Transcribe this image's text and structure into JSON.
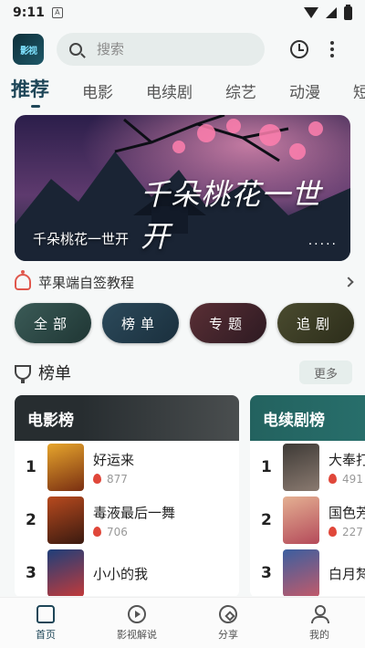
{
  "status_bar": {
    "time": "9:11",
    "notification_letter": "A"
  },
  "app": {
    "logo_text": "影视"
  },
  "search": {
    "placeholder": "搜索"
  },
  "tabs": [
    {
      "label": "推荐"
    },
    {
      "label": "电影"
    },
    {
      "label": "电续剧"
    },
    {
      "label": "综艺"
    },
    {
      "label": "动漫"
    },
    {
      "label": "短"
    }
  ],
  "banner": {
    "caption": "千朵桃花一世开",
    "calligraphy": "千朵桃花一世开",
    "dots": "....."
  },
  "notice": {
    "text": "苹果端自签教程"
  },
  "categories": [
    {
      "label": "全部"
    },
    {
      "label": "榜单"
    },
    {
      "label": "专题"
    },
    {
      "label": "追剧"
    }
  ],
  "ranking": {
    "title": "榜单",
    "more_label": "更多",
    "cards": [
      {
        "title": "电影榜",
        "items": [
          {
            "rank": "1",
            "title": "好运来",
            "heat": "877"
          },
          {
            "rank": "2",
            "title": "毒液最后一舞",
            "heat": "706"
          },
          {
            "rank": "3",
            "title": "小小的我",
            "heat": ""
          }
        ]
      },
      {
        "title": "电续剧榜",
        "items": [
          {
            "rank": "1",
            "title": "大奉打",
            "heat": "491"
          },
          {
            "rank": "2",
            "title": "国色芳",
            "heat": "227"
          },
          {
            "rank": "3",
            "title": "白月梵",
            "heat": ""
          }
        ]
      }
    ]
  },
  "bottom_nav": [
    {
      "label": "首页",
      "icon": "home-icon"
    },
    {
      "label": "影视解说",
      "icon": "play-icon"
    },
    {
      "label": "分享",
      "icon": "compass-icon"
    },
    {
      "label": "我的",
      "icon": "user-icon"
    }
  ]
}
